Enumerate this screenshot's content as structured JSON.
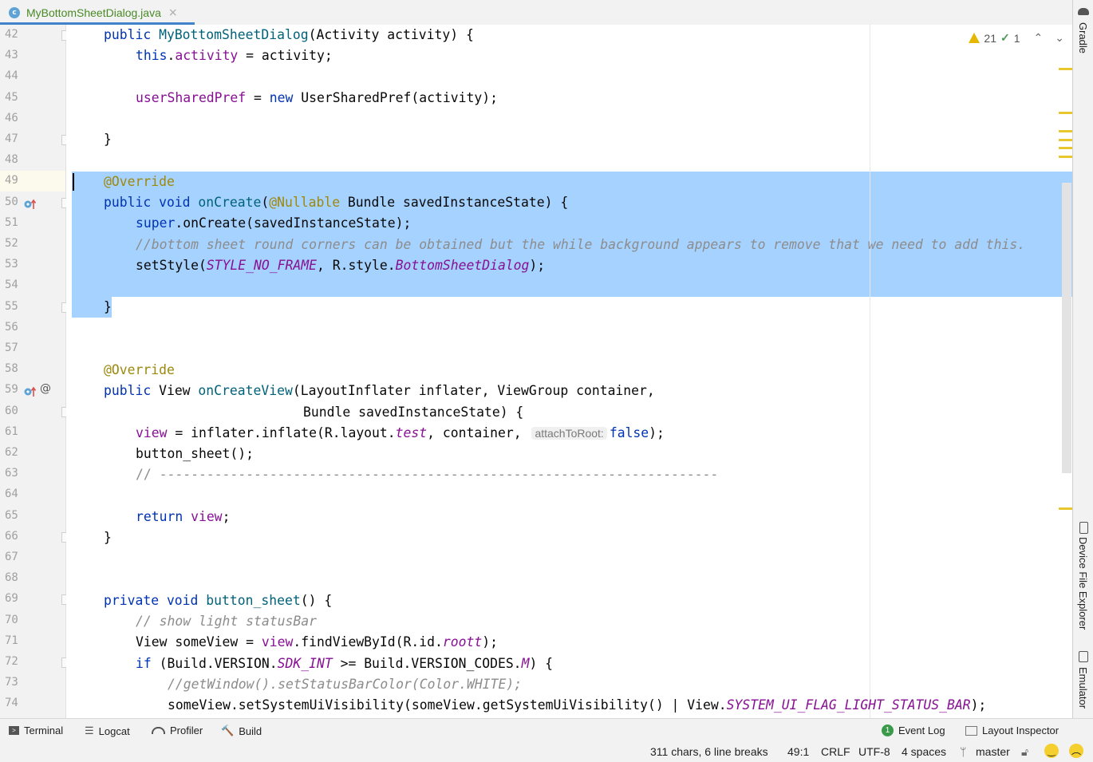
{
  "editor_tab": {
    "icon": "c",
    "label": "MyBottomSheetDialog.java",
    "close": "×"
  },
  "inspections": {
    "warnings": "21",
    "weak_warnings": "1"
  },
  "right_tools": [
    {
      "label": "Gradle"
    },
    {
      "label": "Device File Explorer"
    },
    {
      "label": "Emulator"
    }
  ],
  "gutter": {
    "line_numbers": [
      "42",
      "43",
      "44",
      "45",
      "46",
      "47",
      "48",
      "49",
      "50",
      "51",
      "52",
      "53",
      "54",
      "55",
      "56",
      "57",
      "58",
      "59",
      "60",
      "61",
      "62",
      "63",
      "64",
      "65",
      "66",
      "67",
      "68",
      "69",
      "70",
      "71",
      "72",
      "73",
      "74"
    ]
  },
  "code": {
    "l42": {
      "kw": "public ",
      "name": "MyBottomSheetDialog",
      "rest": "(Activity activity) {"
    },
    "l43": {
      "kw": "this",
      "dot": ".",
      "fld": "activity",
      "rest": " = activity;"
    },
    "l45": {
      "fld": "userSharedPref",
      "eq": " = ",
      "kw": "new ",
      "rest": "UserSharedPref(activity);"
    },
    "l47": "}",
    "l49": "@Override",
    "l50": {
      "kw": "public void ",
      "mt": "onCreate",
      "p1": "(",
      "ann": "@Nullable",
      "rest": " Bundle savedInstanceState) {"
    },
    "l51": {
      "kw": "super",
      "rest": ".onCreate(savedInstanceState);"
    },
    "l52": "//bottom sheet round corners can be obtained but the while background appears to remove that we need to add this.",
    "l53": {
      "a": "setStyle(",
      "cst": "STYLE_NO_FRAME",
      "b": ", R.style.",
      "cst2": "BottomSheetDialog",
      "c": ");"
    },
    "l55": "}",
    "l58": "@Override",
    "l59": {
      "kw": "public ",
      "t": "View ",
      "mt": "onCreateView",
      "rest": "(LayoutInflater inflater, ViewGroup container,"
    },
    "l60": "Bundle savedInstanceState) {",
    "l61": {
      "fld": "view",
      "a": " = inflater.inflate(R.layout.",
      "cst": "test",
      "b": ", container, ",
      "hint": "attachToRoot:",
      "kw": "false",
      "c": ");"
    },
    "l62": "button_sheet();",
    "l63": "// -----------------------------------------------------------------------",
    "l65": {
      "kw": "return ",
      "fld": "view",
      "rest": ";"
    },
    "l66": "}",
    "l69": {
      "kw": "private void ",
      "mt": "button_sheet",
      "rest": "() {"
    },
    "l70": "// show light statusBar",
    "l71": {
      "a": "View someView = ",
      "fld": "view",
      "b": ".findViewById(R.id.",
      "cst": "roott",
      "c": ");"
    },
    "l72": {
      "kw": "if ",
      "a": "(Build.VERSION.",
      "cst": "SDK_INT",
      "b": " >= Build.VERSION_CODES.",
      "cst2": "M",
      "c": ") {"
    },
    "l73": "//getWindow().setStatusBarColor(Color.WHITE);",
    "l74": {
      "a": "someView.setSystemUiVisibility(someView.getSystemUiVisibility() | View.",
      "cst": "SYSTEM_UI_FLAG_LIGHT_STATUS_BAR",
      "c": ");"
    }
  },
  "bottom_tools": {
    "terminal": "Terminal",
    "logcat": "Logcat",
    "profiler": "Profiler",
    "build": "Build",
    "event_log_count": "1",
    "event_log": "Event Log",
    "layout_inspector": "Layout Inspector"
  },
  "status_bar": {
    "selection": "311 chars, 6 line breaks",
    "position": "49:1",
    "line_sep": "CRLF",
    "encoding": "UTF-8",
    "indent": "4 spaces",
    "branch": "master"
  },
  "colors": {
    "selection": "#a6d2ff",
    "keyword": "#0033b3",
    "field": "#871094",
    "annotation": "#9e880d",
    "comment": "#8c8c8c",
    "tab_accent": "#4083c9"
  }
}
